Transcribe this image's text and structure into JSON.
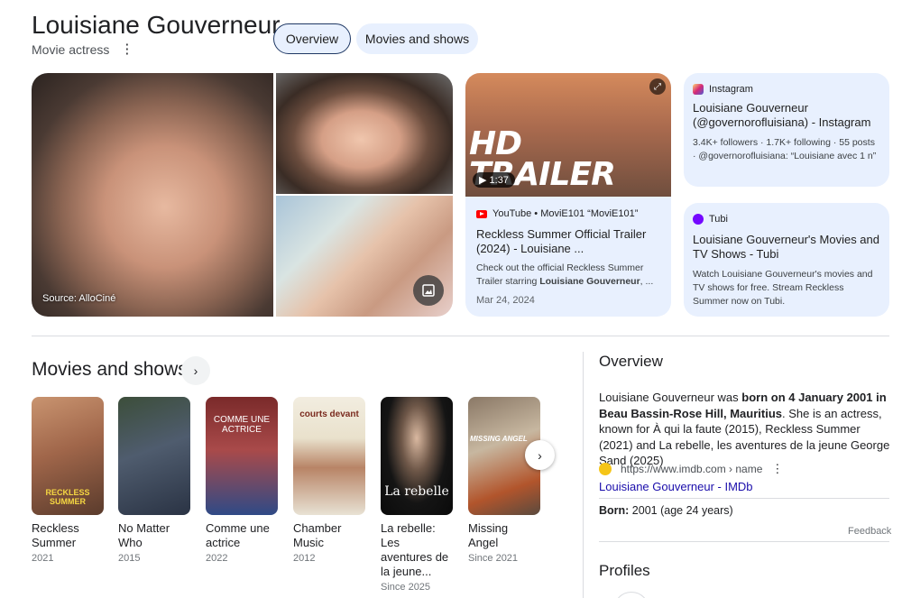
{
  "header": {
    "name": "Louisiane Gouverneur",
    "subtitle": "Movie actress",
    "more_icon": "⋮"
  },
  "tabs": [
    {
      "label": "Overview",
      "selected": true
    },
    {
      "label": "Movies and shows",
      "selected": false
    }
  ],
  "images": {
    "source_label": "Source: AlloCiné",
    "gallery_icon": "image-gallery-icon"
  },
  "youtube_card": {
    "thumb_text": "HD\nTRAILER",
    "duration": "▶ 1:37",
    "source": "YouTube • MoviE101 “MoviE101”",
    "title": "Reckless Summer Official Trailer (2024) - Louisiane ...",
    "snippet_pre": "Check out the official Reckless Summer Trailer starring ",
    "snippet_bold": "Louisiane Gouverneur",
    "snippet_post": ", ...",
    "date": "Mar 24, 2024"
  },
  "instagram_card": {
    "source": "Instagram",
    "title": "Louisiane Gouverneur (@governorofluisiana) - Instagram",
    "snippet": "3.4K+ followers · 1.7K+ following · 55 posts · @governorofluisiana: “Louisiane avec 1 n”"
  },
  "tubi_card": {
    "source": "Tubi",
    "title": "Louisiane Gouverneur's Movies and TV Shows - Tubi",
    "snippet": "Watch Louisiane Gouverneur's movies and TV shows for free. Stream Reckless Summer now on Tubi."
  },
  "movies_section": {
    "title": "Movies and shows",
    "items": [
      {
        "title": "Reckless Summer",
        "year": "2021",
        "poster_text": "RECKLESS SUMMER"
      },
      {
        "title": "No Matter Who",
        "year": "2015",
        "poster_text": ""
      },
      {
        "title": "Comme une actrice",
        "year": "2022",
        "poster_text": "COMME UNE ACTRICE"
      },
      {
        "title": "Chamber Music",
        "year": "2012",
        "poster_text": "courts devant"
      },
      {
        "title": "La rebelle: Les aventures de la jeune...",
        "year": "Since 2025",
        "poster_text": "La rebelle"
      },
      {
        "title": "Missing Angel",
        "year": "Since 2021",
        "poster_text": "MISSING ANGEL"
      }
    ]
  },
  "overview": {
    "title": "Overview",
    "desc_pre": "Louisiane Gouverneur was ",
    "desc_bold": "born on 4 January 2001 in Beau Bassin-Rose Hill, Mauritius",
    "desc_post": ". She is an actress, known for À qui la faute (2015), Reckless Summer (2021) and La rebelle, les aventures de la jeune George Sand (2025)",
    "source_url": "https://www.imdb.com › name",
    "source_link": "Louisiane Gouverneur - IMDb",
    "born_label": "Born:",
    "born_value": " 2001 (age 24 years)",
    "feedback": "Feedback",
    "profiles_title": "Profiles"
  }
}
